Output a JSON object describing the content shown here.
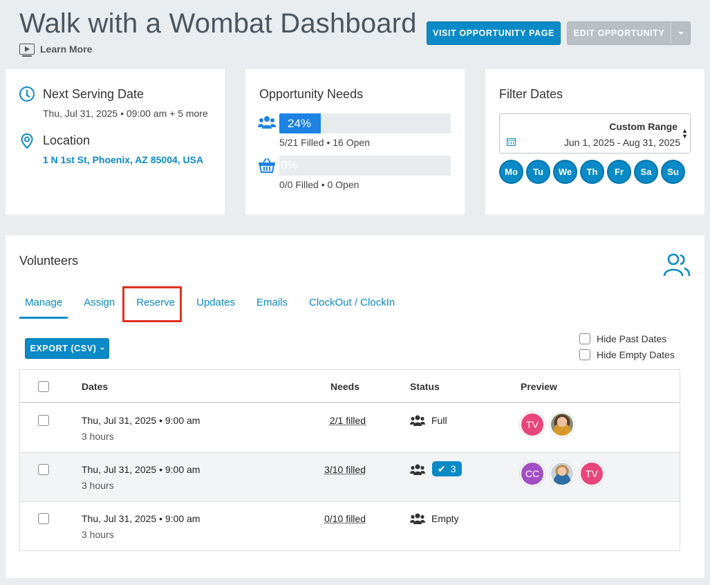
{
  "header": {
    "title": "Walk with a Wombat Dashboard",
    "learn_more": "Learn More",
    "visit_button": "VISIT OPPORTUNITY PAGE",
    "edit_button": "EDIT OPPORTUNITY"
  },
  "serving": {
    "next_label": "Next Serving Date",
    "next_date": "Thu, Jul 31, 2025 • 09:00 am + 5 more",
    "location_label": "Location",
    "location_address": "1 N 1st St, Phoenix, AZ 85004, USA"
  },
  "needs": {
    "title": "Opportunity Needs",
    "volunteers": {
      "percent_label": "24%",
      "fill_percent": 24,
      "caption": "5/21 Filled • 16 Open"
    },
    "items": {
      "percent_label": "0%",
      "fill_percent": 0,
      "caption": "0/0 Filled • 0 Open"
    }
  },
  "filter": {
    "title": "Filter Dates",
    "range_title": "Custom Range",
    "range_value": "Jun 1, 2025 - Aug 31, 2025",
    "days": [
      "Mo",
      "Tu",
      "We",
      "Th",
      "Fr",
      "Sa",
      "Su"
    ]
  },
  "volunteers": {
    "title": "Volunteers",
    "tabs": [
      "Manage",
      "Assign",
      "Reserve",
      "Updates",
      "Emails",
      "ClockOut / ClockIn"
    ],
    "active_tab": "Manage",
    "export_button": "EXPORT (CSV)",
    "hide_past": "Hide Past Dates",
    "hide_empty": "Hide Empty Dates",
    "columns": {
      "dates": "Dates",
      "needs": "Needs",
      "status": "Status",
      "preview": "Preview"
    },
    "rows": [
      {
        "date": "Thu, Jul 31, 2025 • 9:00 am",
        "duration": "3 hours",
        "needs": "2/1 filled",
        "status": "Full",
        "badge": "",
        "avatars": [
          "TV",
          "photo"
        ]
      },
      {
        "date": "Thu, Jul 31, 2025 • 9:00 am",
        "duration": "3 hours",
        "needs": "3/10 filled",
        "status": "",
        "badge": "3",
        "avatars": [
          "CC",
          "photo",
          "TV"
        ]
      },
      {
        "date": "Thu, Jul 31, 2025 • 9:00 am",
        "duration": "3 hours",
        "needs": "0/10 filled",
        "status": "Empty",
        "badge": "",
        "avatars": []
      }
    ]
  },
  "colors": {
    "accent": "#0a8ac7",
    "progress": "#1c82e4",
    "highlight": "#e0311f"
  }
}
